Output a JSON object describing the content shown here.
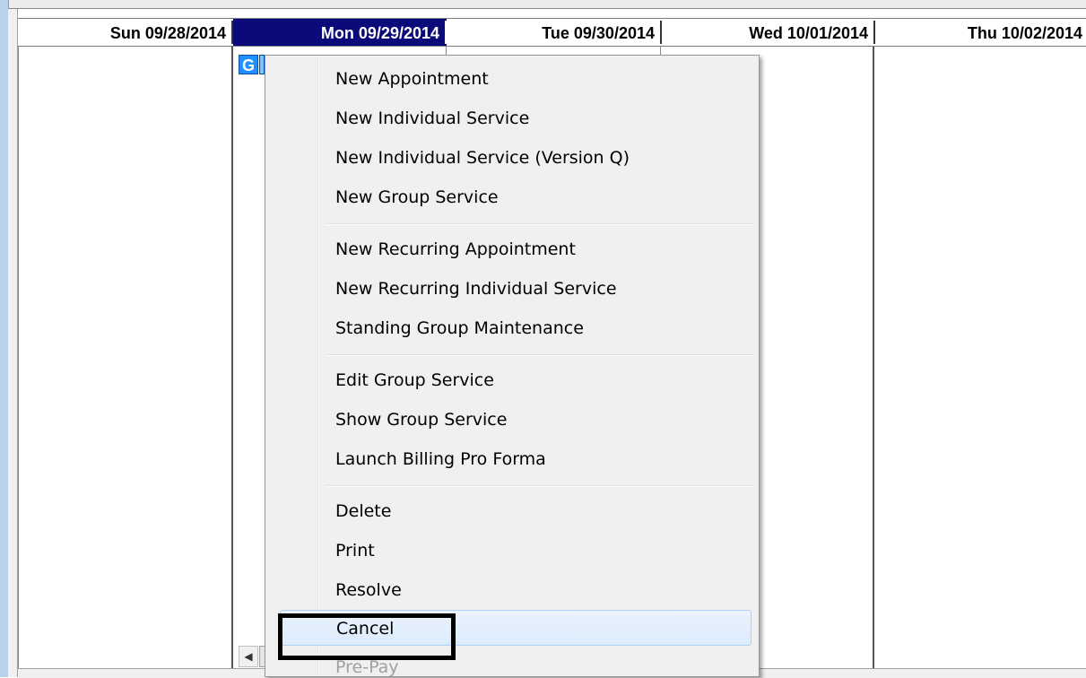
{
  "calendar": {
    "days": [
      {
        "label": "Sun 09/28/2014",
        "selected": false
      },
      {
        "label": "Mon 09/29/2014",
        "selected": true
      },
      {
        "label": "Tue 09/30/2014",
        "selected": false
      },
      {
        "label": "Wed 10/01/2014",
        "selected": false
      },
      {
        "label": "Thu 10/02/2014",
        "selected": false
      }
    ],
    "appointment": {
      "badge": "G",
      "color": "#1e90ff"
    },
    "scroll_left_glyph": "◀"
  },
  "context_menu": {
    "groups": [
      [
        "New Appointment",
        "New Individual Service",
        "New Individual Service (Version Q)",
        "New Group Service"
      ],
      [
        "New Recurring Appointment",
        "New Recurring Individual Service",
        "Standing Group Maintenance"
      ],
      [
        "Edit Group Service",
        "Show Group Service",
        "Launch Billing Pro Forma"
      ],
      [
        "Delete",
        "Print",
        "Resolve",
        "Cancel",
        "Pre-Pay"
      ]
    ],
    "hovered_item": "Cancel",
    "disabled_items": [
      "Pre-Pay"
    ]
  },
  "colors": {
    "selected_header_bg": "#0a0a7a",
    "menu_bg": "#f0f0f0",
    "hover_border": "#aecff7",
    "highlight_box": "#000000"
  }
}
